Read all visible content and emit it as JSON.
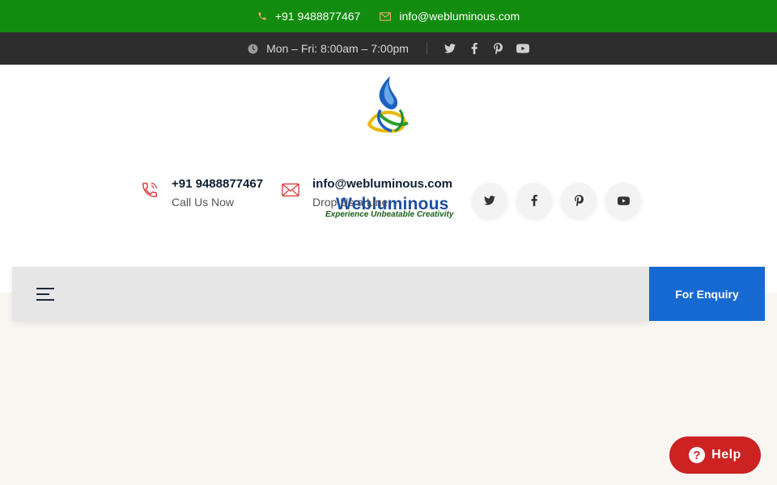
{
  "topbar": {
    "phone": "+91 9488877467",
    "email": "info@webluminous.com",
    "hours": "Mon – Fri: 8:00am – 7:00pm",
    "social_icons": [
      "twitter-icon",
      "facebook-icon",
      "pinterest-icon",
      "youtube-icon"
    ]
  },
  "logo": {
    "name": "Webluminous",
    "tagline": "Experience Unbeatable Creativity"
  },
  "contacts": [
    {
      "icon": "phone-icon",
      "value": "+91 9488877467",
      "label": "Call Us Now"
    },
    {
      "icon": "mail-icon",
      "value": "info@webluminous.com",
      "label": "Drop Us a Line"
    }
  ],
  "nav": {
    "enquiry_label": "For Enquiry"
  },
  "help": {
    "label": "Help",
    "icon_glyph": "?"
  },
  "colors": {
    "green_bar": "#128c0e",
    "dark_bar": "#2d2d2d",
    "accent_blue": "#1669d0",
    "help_red": "#cc2222"
  }
}
